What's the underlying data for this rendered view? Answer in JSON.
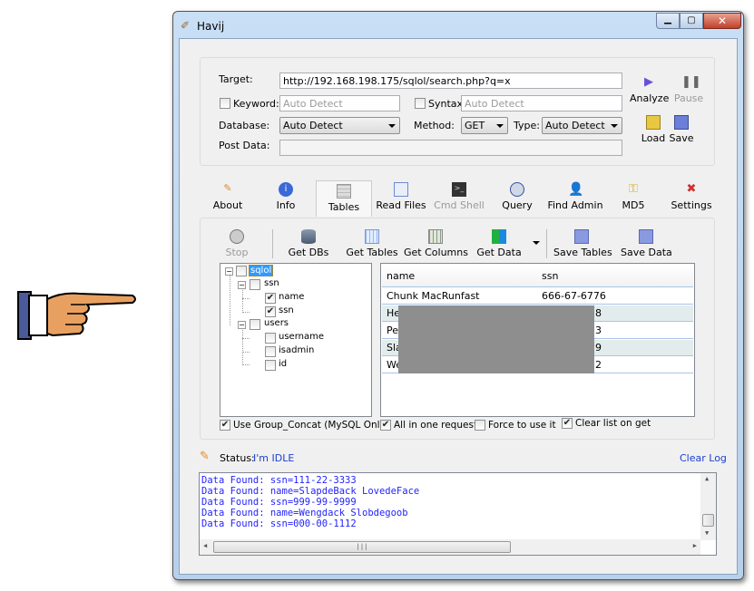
{
  "window": {
    "title": "Havij"
  },
  "target": {
    "label": "Target:",
    "value": "http://192.168.198.175/sqlol/search.php?q=x"
  },
  "keyword": {
    "label": "Keyword:",
    "placeholder": "Auto Detect",
    "checked": false
  },
  "syntax": {
    "label": "Syntax:",
    "placeholder": "Auto Detect",
    "checked": false
  },
  "database": {
    "label": "Database:",
    "value": "Auto Detect"
  },
  "method": {
    "label": "Method:",
    "value": "GET"
  },
  "type": {
    "label": "Type:",
    "value": "Auto Detect"
  },
  "post_data": {
    "label": "Post Data:",
    "value": ""
  },
  "actions": {
    "analyze": "Analyze",
    "pause": "Pause",
    "load": "Load",
    "save": "Save"
  },
  "tabs": [
    "About",
    "Info",
    "Tables",
    "Read Files",
    "Cmd Shell",
    "Query",
    "Find Admin",
    "MD5",
    "Settings"
  ],
  "toolbar": {
    "stop": "Stop",
    "get_dbs": "Get DBs",
    "get_tables": "Get Tables",
    "get_columns": "Get Columns",
    "get_data": "Get Data",
    "save_tables": "Save Tables",
    "save_data": "Save Data"
  },
  "tree": {
    "db": "sqlol",
    "t1": "ssn",
    "t1c1": "name",
    "t1c2": "ssn",
    "t2": "users",
    "t2c1": "username",
    "t2c2": "isadmin",
    "t2c3": "id"
  },
  "grid": {
    "headers": [
      "name",
      "ssn"
    ],
    "rows": [
      [
        "Chunk MacRunfast",
        "666-67-6776"
      ],
      [
        "He",
        "8"
      ],
      [
        "Pe",
        "3"
      ],
      [
        "Sla",
        "9"
      ],
      [
        "We",
        "2"
      ]
    ]
  },
  "options": {
    "group_concat": "Use Group_Concat (MySQL Only)",
    "all_in_one": "All in one request.",
    "force": "Force to use it",
    "clear_list": "Clear list on get"
  },
  "status": {
    "label": "Status:",
    "value": "I'm IDLE",
    "clear_log": "Clear Log"
  },
  "log": [
    "Data Found: ssn=111-22-3333",
    "Data Found: name=SlapdeBack LovedeFace",
    "Data Found: ssn=999-99-9999",
    "Data Found: name=Wengdack Slobdegoob",
    "Data Found: ssn=000-00-1112"
  ],
  "colors": {
    "log_text": "#2323ff",
    "status_value": "#1a3fd0",
    "selection": "#3399ff"
  }
}
